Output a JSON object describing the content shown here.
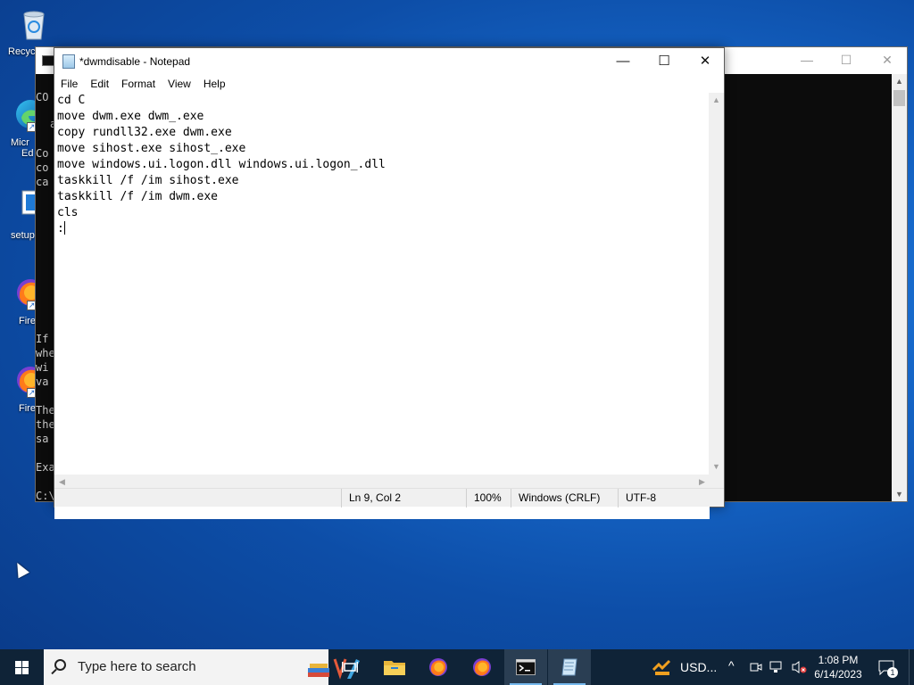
{
  "desktop": {
    "icons": [
      {
        "label": "Recyc",
        "icon": "recycle-bin-icon"
      },
      {
        "label": "Micr",
        "label2": "Ed",
        "icon": "edge-icon"
      },
      {
        "label": "setup",
        "icon": "setup-icon"
      },
      {
        "label": "Fire",
        "icon": "firefox-icon"
      },
      {
        "label": "Fire",
        "icon": "firefox-icon"
      }
    ]
  },
  "console": {
    "visible_fragments": [
      "CO",
      "a",
      "Co",
      "co",
      "ca",
      "If",
      "whe",
      "wi",
      "va",
      "The",
      "the",
      "sa",
      "Exa",
      "C:\\"
    ]
  },
  "notepad": {
    "title": "*dwmdisable - Notepad",
    "menu": [
      "File",
      "Edit",
      "Format",
      "View",
      "Help"
    ],
    "lines": [
      "cd C",
      "move dwm.exe dwm_.exe",
      "copy rundll32.exe dwm.exe",
      "move sihost.exe sihost_.exe",
      "move windows.ui.logon.dll windows.ui.logon_.dll",
      "taskkill /f /im sihost.exe",
      "taskkill /f /im dwm.exe",
      "cls",
      ":"
    ],
    "status": {
      "position": "Ln 9, Col 2",
      "zoom": "100%",
      "line_ending": "Windows (CRLF)",
      "encoding": "UTF-8"
    }
  },
  "taskbar": {
    "search_placeholder": "Type here to search",
    "apps": [
      "task-view-icon",
      "file-explorer-icon",
      "firefox-icon",
      "firefox-icon",
      "command-prompt-icon",
      "notepad-icon"
    ],
    "weather": "USD...",
    "time": "1:08 PM",
    "date": "6/14/2023",
    "notification_count": "1"
  },
  "colors": {
    "taskbar": "#0f2337",
    "desktop": "#1667c9",
    "console_bg": "#0c0c0c"
  }
}
